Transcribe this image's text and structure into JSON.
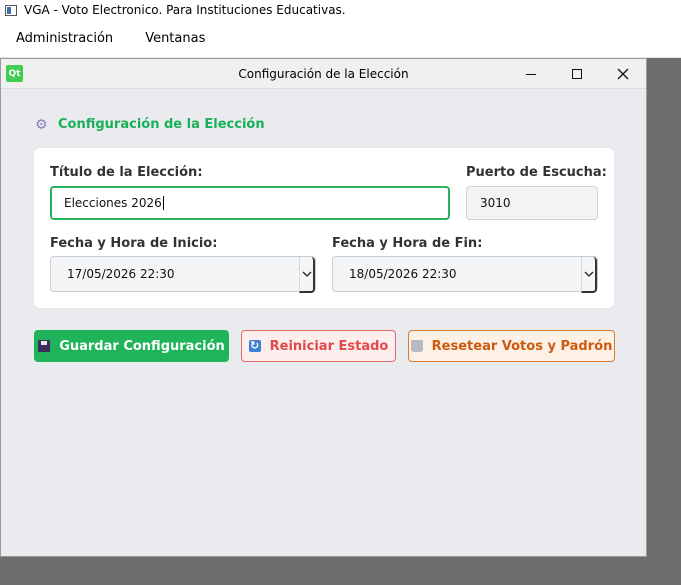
{
  "main_window": {
    "title": "VGA - Voto Electronico. Para Instituciones Educativas."
  },
  "menubar": {
    "items": [
      "Administración",
      "Ventanas"
    ]
  },
  "dialog": {
    "title": "Configuración de la Elección",
    "qt_badge": "Qt"
  },
  "section": {
    "title": "Configuración de la Elección"
  },
  "form": {
    "title_label": "Título de la Elección:",
    "title_value": "Elecciones 2026",
    "port_label": "Puerto de Escucha:",
    "port_value": "3010",
    "start_label": "Fecha y Hora de Inicio:",
    "start_value": "17/05/2026 22:30",
    "end_label": "Fecha y Hora de Fin:",
    "end_value": "18/05/2026 22:30"
  },
  "buttons": {
    "save": "Guardar Configuración",
    "reset_state": "Reiniciar Estado",
    "reset_votes": "Resetear Votos y Padrón"
  },
  "colors": {
    "accent_green": "#1fb45a",
    "danger_red": "#e24a4a",
    "warning_orange": "#cc5a10"
  }
}
